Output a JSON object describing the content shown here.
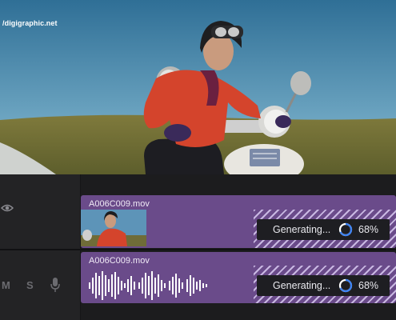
{
  "watermark": "/digigraphic.net",
  "track_controls": {
    "mute_label": "M",
    "solo_label": "S"
  },
  "clips": [
    {
      "name": "A006C009.mov",
      "status_label": "Generating...",
      "progress_text": "68%",
      "progress": 0.68
    },
    {
      "name": "A006C009.mov",
      "status_label": "Generating...",
      "progress_text": "68%",
      "progress": 0.68
    }
  ],
  "colors": {
    "clip_fill": "#6a4b8a",
    "spinner_accent": "#3b82f6",
    "panel": "#232325"
  },
  "icons": [
    "eye-icon",
    "microphone-icon",
    "spinner-icon",
    "waveform-icon"
  ]
}
